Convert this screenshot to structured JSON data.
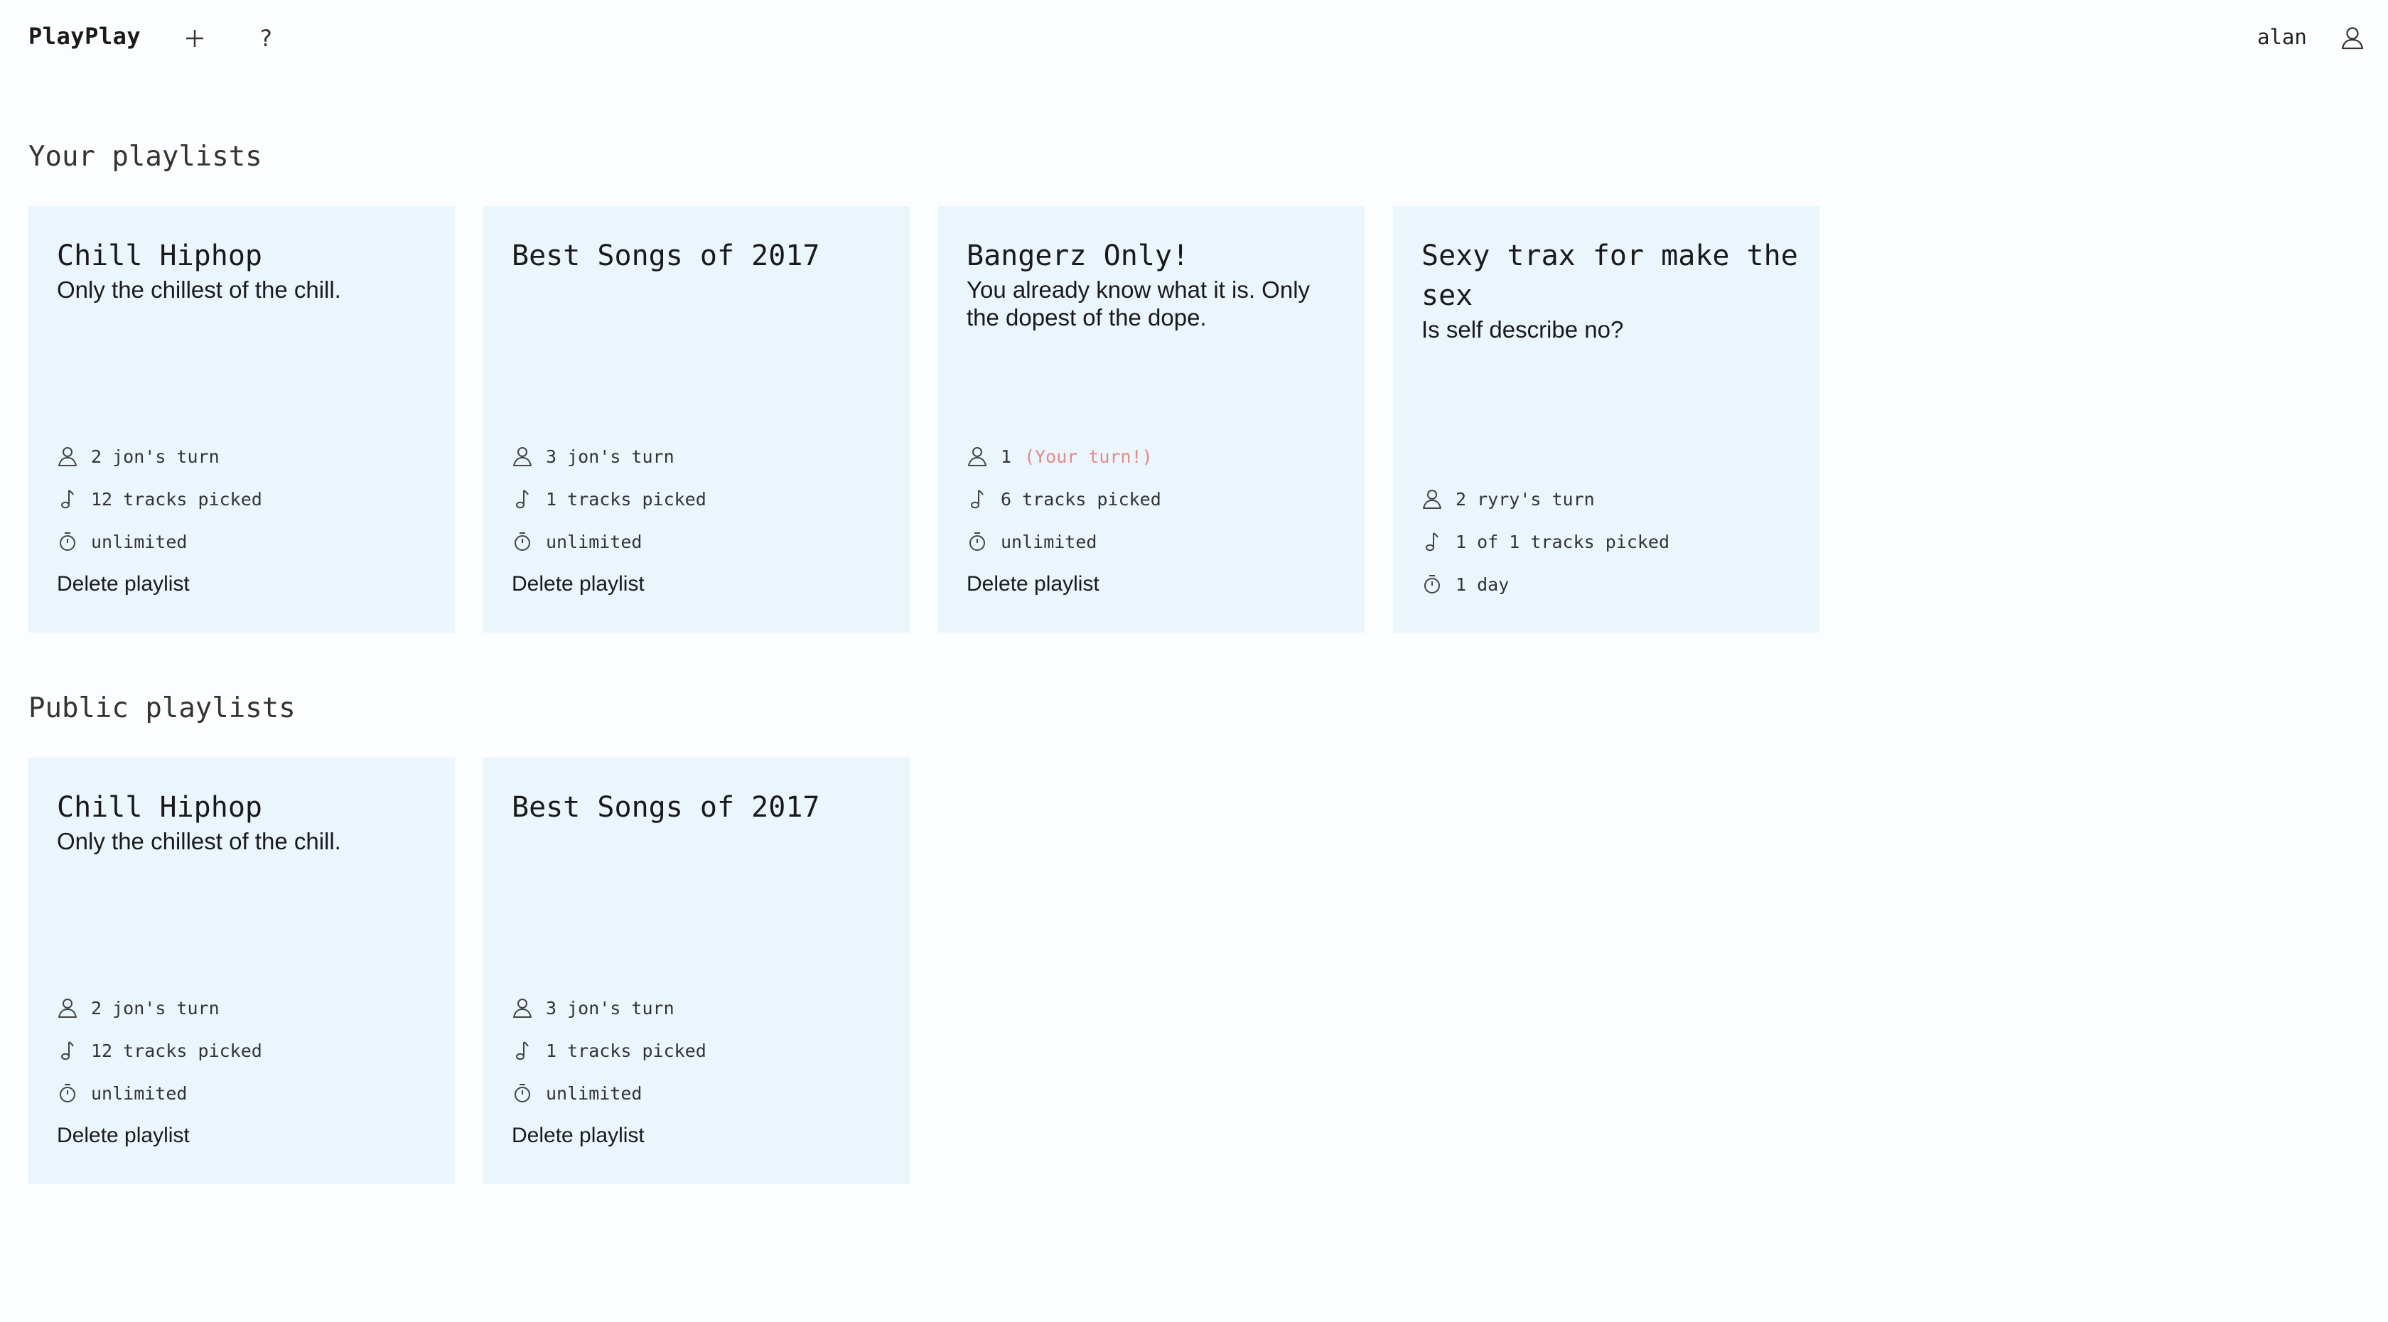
{
  "app": {
    "brand": "PlayPlay",
    "username": "alan"
  },
  "sections": {
    "yours": "Your playlists",
    "public": "Public playlists"
  },
  "your_playlists": [
    {
      "title": "Chill Hiphop",
      "description": "Only the chillest of the chill.",
      "players": "2",
      "turn": "jon's turn",
      "tracks": "12 tracks picked",
      "duration": "unlimited",
      "delete": "Delete playlist"
    },
    {
      "title": "Best Songs of 2017",
      "description": "",
      "players": "3",
      "turn": "jon's turn",
      "tracks": "1 tracks picked",
      "duration": "unlimited",
      "delete": "Delete playlist"
    },
    {
      "title": "Bangerz Only!",
      "description": "You already know what it is. Only the dopest of the dope.",
      "players": "1",
      "turn": "(Your turn!)",
      "tracks": "6 tracks picked",
      "duration": "unlimited",
      "delete": "Delete playlist"
    },
    {
      "title": "Sexy trax for make the sex",
      "description": "Is self describe no?",
      "players": "2",
      "turn": "ryry's turn",
      "tracks": "1 of 1 tracks picked",
      "duration": "1 day"
    }
  ],
  "public_playlists": [
    {
      "title": "Chill Hiphop",
      "description": "Only the chillest of the chill.",
      "players": "2",
      "turn": "jon's turn",
      "tracks": "12 tracks picked",
      "duration": "unlimited",
      "delete": "Delete playlist"
    },
    {
      "title": "Best Songs of 2017",
      "description": "",
      "players": "3",
      "turn": "jon's turn",
      "tracks": "1 tracks picked",
      "duration": "unlimited",
      "delete": "Delete playlist"
    }
  ],
  "icons": {
    "add": "plus-icon",
    "help": "?",
    "user": "user-icon",
    "players": "user-icon",
    "tracks": "music-note-icon",
    "duration": "stopwatch-icon"
  },
  "colors": {
    "background": "#fbfdfe",
    "card": "#ebf5fc",
    "your_turn": "#e58a8a"
  }
}
